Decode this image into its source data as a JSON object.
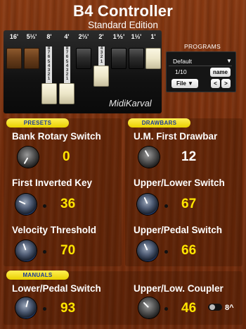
{
  "header": {
    "title": "B4 Controller",
    "subtitle": "Standard Edition"
  },
  "drawbars": {
    "labels": [
      "16'",
      "5⅓'",
      "8'",
      "4'",
      "2⅔'",
      "2'",
      "1⅗'",
      "1⅓'",
      "1'"
    ],
    "scale_a": "8\n7\n6\n5\n4\n3\n2\n1",
    "scale_b": "8\n7\n6\n5\n4\n3\n2\n1",
    "scale_c": "4\n3\n2\n1",
    "brand": "MidiKarval"
  },
  "programs": {
    "title": "PROGRAMS",
    "selected": "Default",
    "dropdown_icon": "▼",
    "count": "1/10",
    "name_button": "name",
    "file_button": "File ▼",
    "prev_button": "<",
    "next_button": ">"
  },
  "sections": {
    "presets": "PRESETS",
    "drawbars": "DRAWBARS",
    "manuals": "MANUALS"
  },
  "params": {
    "bank_rotary": {
      "label": "Bank Rotary Switch",
      "value": "0"
    },
    "um_first_drawbar": {
      "label": "U.M. First Drawbar",
      "value": "12"
    },
    "first_inverted_key": {
      "label": "First Inverted Key",
      "value": "36"
    },
    "upper_lower_switch": {
      "label": "Upper/Lower Switch",
      "value": "67"
    },
    "velocity_threshold": {
      "label": "Velocity Threshold",
      "value": "70"
    },
    "upper_pedal_switch": {
      "label": "Upper/Pedal Switch",
      "value": "66"
    },
    "lower_pedal_switch": {
      "label": "Lower/Pedal Switch",
      "value": "93"
    },
    "upper_low_coupler": {
      "label": "Upper/Low. Coupler",
      "value": "46"
    }
  },
  "coupler_toggle": {
    "label": "8^"
  },
  "colors": {
    "accent_yellow": "#ffe600",
    "badge_yellow": "#f3e000",
    "badge_text": "#1a3a99",
    "knob_blue": "#1f64e0"
  }
}
